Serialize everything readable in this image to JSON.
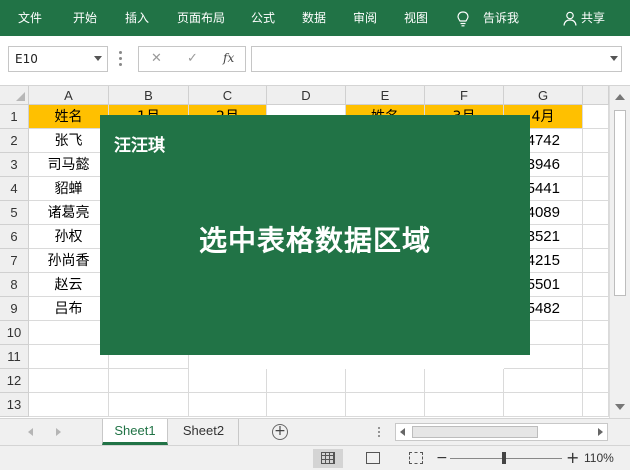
{
  "ribbon": {
    "tabs": [
      "文件",
      "开始",
      "插入",
      "页面布局",
      "公式",
      "数据",
      "审阅",
      "视图"
    ],
    "tell_me": "告诉我",
    "share": "共享"
  },
  "formula_bar": {
    "name_box": "E10",
    "cancel_icon": "✕",
    "enter_icon": "✓",
    "fx_label": "fx",
    "formula": ""
  },
  "sheet": {
    "columns": [
      "A",
      "B",
      "C",
      "D",
      "E",
      "F",
      "G"
    ],
    "rows": [
      "1",
      "2",
      "3",
      "4",
      "5",
      "6",
      "7",
      "8",
      "9",
      "10",
      "11",
      "12",
      "13"
    ],
    "cells": {
      "A1": "姓名",
      "B1": "1月",
      "C1": "2月",
      "E1": "姓名",
      "F1": "3月",
      "G1": "4月",
      "A2": "张飞",
      "A3": "司马懿",
      "A4": "貂蝉",
      "A5": "诸葛亮",
      "A6": "孙权",
      "A7": "孙尚香",
      "A8": "赵云",
      "A9": "吕布",
      "G2": "4742",
      "G3": "3946",
      "G4": "5441",
      "G5": "4089",
      "G6": "3521",
      "G7": "4215",
      "G8": "5501",
      "G9": "5482"
    }
  },
  "overlay": {
    "brand": "汪汪琪",
    "caption": "选中表格数据区域"
  },
  "tabs": {
    "sheets": [
      "Sheet1",
      "Sheet2"
    ],
    "add_icon": "+"
  },
  "status": {
    "zoom_minus": "−",
    "zoom_plus": "+",
    "zoom": "110%"
  },
  "colors": {
    "accent": "#217346",
    "header_fill": "#ffc000"
  }
}
